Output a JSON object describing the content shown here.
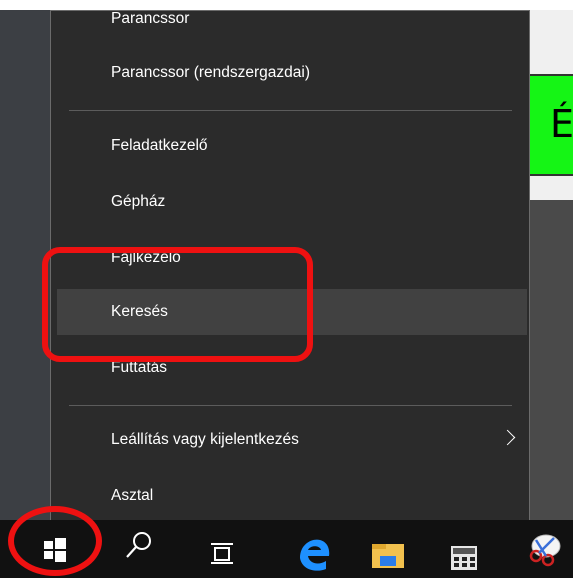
{
  "context_menu": {
    "items": [
      {
        "label": "Parancssor"
      },
      {
        "label": "Parancssor (rendszergazdai)"
      },
      {
        "label": "Feladatkezelő"
      },
      {
        "label": "Gépház"
      },
      {
        "label": "Fájlkezelő"
      },
      {
        "label": "Keresés"
      },
      {
        "label": "Futtatás"
      },
      {
        "label": "Leállítás vagy kijelentkezés",
        "icon": "chevron-right-icon"
      },
      {
        "label": "Asztal"
      }
    ],
    "highlighted_item": "Keresés"
  },
  "background_app": {
    "fragment_text": "É",
    "accent_color": "#15f515"
  },
  "taskbar": {
    "icons": [
      "windows-start-icon",
      "search-icon",
      "task-view-icon",
      "edge-browser-icon",
      "file-explorer-icon",
      "calculator-icon",
      "snipping-tool-icon"
    ]
  },
  "colors": {
    "menu_background": "#2b2b2b",
    "menu_hover": "#414141",
    "annotation": "#ee1111",
    "taskbar": "#111111"
  }
}
